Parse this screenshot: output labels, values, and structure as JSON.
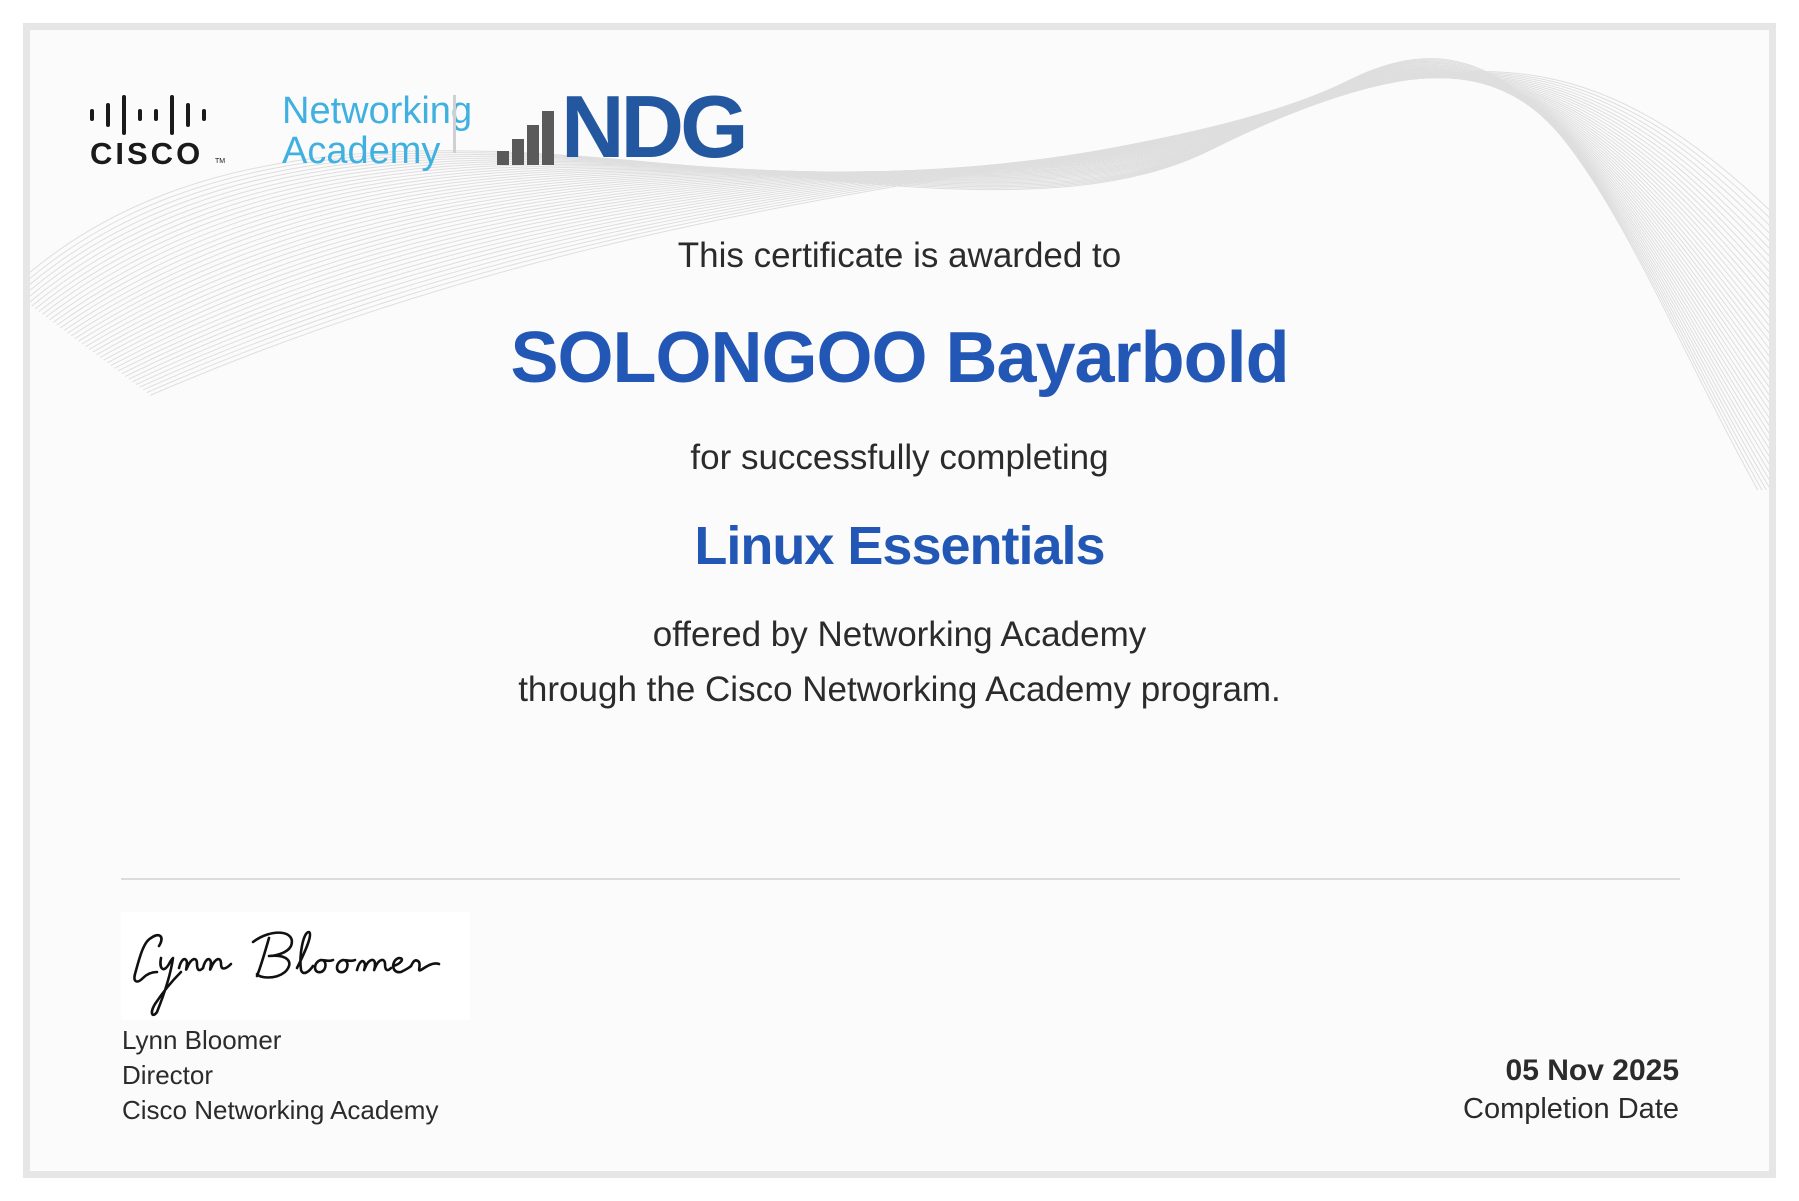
{
  "logos": {
    "cisco_word": "CISCO",
    "cisco_tm": "TM",
    "netacad_line1": "Networking",
    "netacad_line2": "Academy",
    "ndg_text": "NDG"
  },
  "certificate": {
    "awarded_line": "This certificate is awarded to",
    "recipient_name": "SOLONGOO Bayarbold",
    "completing_line": "for successfully completing",
    "course_name": "Linux Essentials",
    "offered_line1": "offered by Networking Academy",
    "offered_line2": "through the Cisco Networking Academy program."
  },
  "signatory": {
    "signature": "Lynn Bloomer",
    "name": "Lynn Bloomer",
    "title": "Director",
    "organization": "Cisco Networking Academy"
  },
  "completion": {
    "date": "05 Nov 2025",
    "label": "Completion Date"
  },
  "colors": {
    "accent_blue": "#2357b5",
    "netacad_cyan": "#3fb0e0",
    "ndg_blue": "#2357a0",
    "ndg_gray": "#5a5a5a",
    "text": "#2b2b2b",
    "frame": "#e6e6e6"
  }
}
